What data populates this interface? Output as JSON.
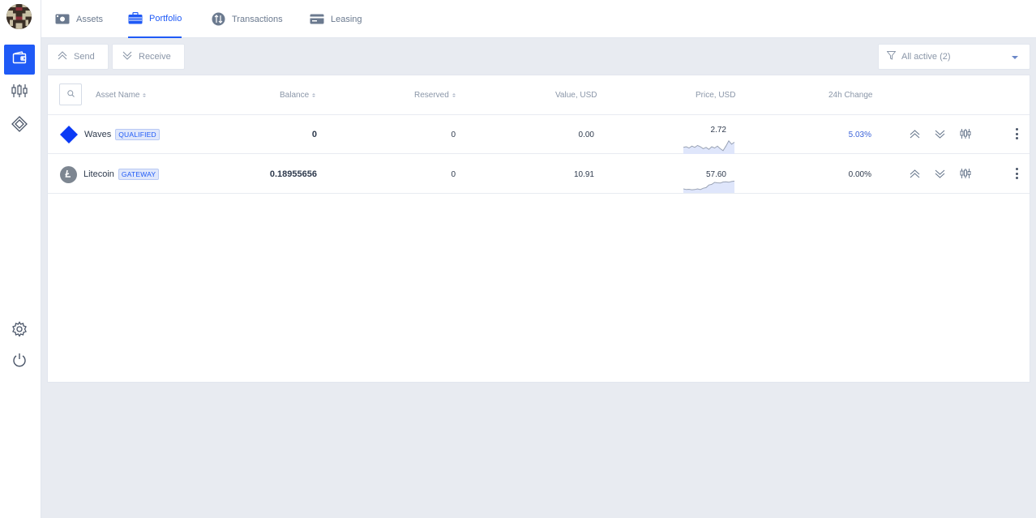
{
  "nav": {
    "tabs": [
      {
        "label": "Assets",
        "icon": "assets-card-icon",
        "active": false
      },
      {
        "label": "Portfolio",
        "icon": "briefcase-icon",
        "active": true
      },
      {
        "label": "Transactions",
        "icon": "transfer-arrows-icon",
        "active": false
      },
      {
        "label": "Leasing",
        "icon": "leasing-card-icon",
        "active": false
      }
    ]
  },
  "sidebar": {
    "items": [
      {
        "icon": "wallet-icon",
        "active": true
      },
      {
        "icon": "candlestick-chart-icon",
        "active": false
      },
      {
        "icon": "dex-diamond-icon",
        "active": false
      },
      {
        "icon": "settings-gear-icon",
        "active": false
      },
      {
        "icon": "power-icon",
        "active": false
      }
    ]
  },
  "actions": {
    "send_label": "Send",
    "receive_label": "Receive",
    "filter_label": "All active (2)"
  },
  "table": {
    "columns": {
      "asset_name": "Asset Name",
      "balance": "Balance",
      "reserved": "Reserved",
      "value": "Value, USD",
      "price": "Price, USD",
      "change": "24h Change"
    },
    "rows": [
      {
        "name": "Waves",
        "badge": "QUALIFIED",
        "icon": "waves-diamond-icon",
        "balance": "0",
        "reserved": "0",
        "value": "0.00",
        "price": "2.72",
        "change": "5.03%",
        "spark": [
          0.45,
          0.5,
          0.4,
          0.55,
          0.45,
          0.6,
          0.5,
          0.35,
          0.45,
          0.3,
          0.5,
          0.4,
          0.55,
          0.35,
          0.2,
          0.55,
          0.95,
          0.7,
          0.85
        ]
      },
      {
        "name": "Litecoin",
        "badge": "GATEWAY",
        "icon": "litecoin-icon",
        "balance": "0.18955656",
        "reserved": "0",
        "value": "10.91",
        "price": "57.60",
        "change": "0.00%",
        "spark": [
          0.25,
          0.2,
          0.22,
          0.18,
          0.2,
          0.25,
          0.2,
          0.3,
          0.35,
          0.55,
          0.6,
          0.75,
          0.72,
          0.7,
          0.78,
          0.8,
          0.76,
          0.82,
          0.85
        ]
      }
    ]
  },
  "colors": {
    "accent": "#1f5af6",
    "background": "#e8ebf1",
    "spark_fill": "#dfe6fb",
    "spark_line": "#9aa3b5"
  }
}
